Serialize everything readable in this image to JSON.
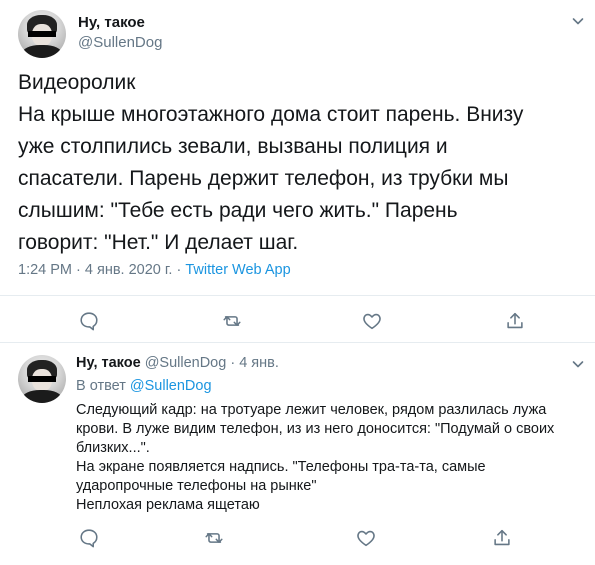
{
  "main_tweet": {
    "author_name": "Ну, такое",
    "author_handle": "@SullenDog",
    "text_lines": [
      "Видеоролик",
      "На крыше многоэтажного дома стоит парень. Внизу",
      "уже столпились зевали, вызваны полиция и",
      "спасатели. Парень держит телефон, из трубки мы",
      "слышим: \"Тебе есть ради чего жить.\" Парень",
      "говорит: \"Нет.\" И делает шаг."
    ],
    "timestamp": "1:24 PM · 4 янв. 2020 г. · ",
    "source_app": "Twitter Web App"
  },
  "reply_tweet": {
    "author_name": "Ну, такое",
    "author_handle": "@SullenDog",
    "date_sep": " · ",
    "date": "4 янв.",
    "reply_prefix": "В ответ ",
    "reply_to": "@SullenDog",
    "text_lines": [
      "Следующий кадр: на тротуаре лежит человек, рядом разлилась лужа",
      "крови. В луже видим телефон, из из него доносится: \"Подумай о своих",
      "близких...\".",
      "На экране появляется надпись. \"Телефоны тра-та-та, самые",
      "ударопрочные телефоны на рынке\"",
      "Неплохая реклама ящетаю"
    ]
  },
  "icons": {
    "reply": "reply-icon",
    "retweet": "retweet-icon",
    "like": "like-icon",
    "share": "share-icon",
    "more": "chevron-down-icon"
  },
  "colors": {
    "text": "#14171a",
    "secondary": "#657786",
    "link": "#1b95e0",
    "divider": "#e6ecf0"
  }
}
